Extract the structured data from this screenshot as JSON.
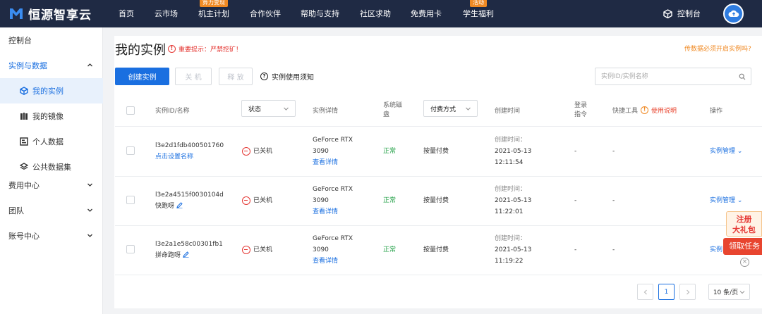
{
  "brand": {
    "name": "恒源智享云"
  },
  "nav": [
    {
      "label": "首页",
      "badge": ""
    },
    {
      "label": "云市场",
      "badge": ""
    },
    {
      "label": "机主计划",
      "badge": "算力变现"
    },
    {
      "label": "合作伙伴",
      "badge": ""
    },
    {
      "label": "帮助与支持",
      "badge": ""
    },
    {
      "label": "社区求助",
      "badge": ""
    },
    {
      "label": "免费用卡",
      "badge": ""
    },
    {
      "label": "学生福利",
      "badge": "活动"
    }
  ],
  "header": {
    "console_label": "控制台",
    "cube_icon": "cube-icon",
    "avatar_icon": "cloud-upload-icon"
  },
  "sidebar": {
    "items": [
      {
        "label": "控制台",
        "type": "top"
      },
      {
        "label": "实例与数据",
        "type": "group-open"
      },
      {
        "label": "我的实例",
        "type": "sub-active",
        "icon": "cube-icon"
      },
      {
        "label": "我的镜像",
        "type": "sub",
        "icon": "image-icon"
      },
      {
        "label": "个人数据",
        "type": "sub",
        "icon": "data-icon"
      },
      {
        "label": "公共数据集",
        "type": "sub",
        "icon": "layers-icon"
      },
      {
        "label": "费用中心",
        "type": "group"
      },
      {
        "label": "团队",
        "type": "group"
      },
      {
        "label": "账号中心",
        "type": "group"
      }
    ]
  },
  "page": {
    "title": "我的实例",
    "warning": "重要提示：严禁挖矿！",
    "top_link": "传数据必须开启实例吗?"
  },
  "toolbar": {
    "create_label": "创建实例",
    "shutdown_label": "关 机",
    "release_label": "释 放",
    "notice_label": "实例使用须知"
  },
  "search": {
    "placeholder": "实例ID/实例名称"
  },
  "table": {
    "headers": {
      "id": "实例ID/名称",
      "status": "状态",
      "detail": "实例详情",
      "disk": "系统磁盘",
      "billing": "付费方式",
      "created": "创建时间",
      "login": "登录指令",
      "tools": "快捷工具",
      "tools_link": "使用说明",
      "ops": "操作"
    },
    "rows": [
      {
        "id": "l3e2d1fdb400501760",
        "name": "点击设置名称",
        "status": "已关机",
        "gpu": "GeForce RTX 3090",
        "detail_link": "查看详情",
        "disk": "正常",
        "billing": "按量付费",
        "created_label": "创建时间：",
        "created_date": "2021-05-13",
        "created_time": "12:11:54",
        "login": "-",
        "tools": "-",
        "ops": "实例管理"
      },
      {
        "id": "l3e2a4515f0030104d",
        "name": "快跑呀",
        "status": "已关机",
        "gpu": "GeForce RTX 3090",
        "detail_link": "查看详情",
        "disk": "正常",
        "billing": "按量付费",
        "created_label": "创建时间：",
        "created_date": "2021-05-13",
        "created_time": "11:22:01",
        "login": "-",
        "tools": "-",
        "ops": "实例管理"
      },
      {
        "id": "l3e2a1e58c00301fb1",
        "name": "拼命跑呀",
        "status": "已关机",
        "gpu": "GeForce RTX 3090",
        "detail_link": "查看详情",
        "disk": "正常",
        "billing": "按量付费",
        "created_label": "创建时间：",
        "created_date": "2021-05-13",
        "created_time": "11:19:22",
        "login": "-",
        "tools": "-",
        "ops": "实例"
      }
    ]
  },
  "pagination": {
    "current": "1",
    "page_size": "10 条/页"
  },
  "promo": {
    "line1": "注册",
    "line2": "大礼包",
    "action": "领取任务"
  },
  "colors": {
    "accent": "#1a6fe0",
    "topbar": "#1f2a44",
    "warning": "#e53935",
    "orange": "#f08a24",
    "ok": "#24a148"
  }
}
